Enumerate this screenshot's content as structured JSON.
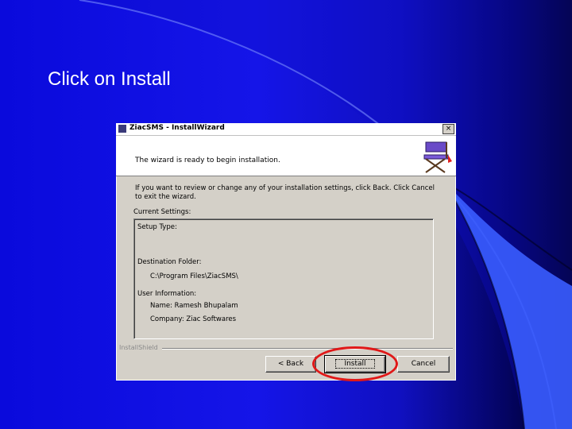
{
  "slide": {
    "title": "Click on Install"
  },
  "dialog": {
    "title": "ZiacSMS - InstallWizard",
    "close_label": "×",
    "banner_text": "The wizard is ready to begin installation.",
    "body_text": "If you want to review or change any of your installation settings, click Back. Click Cancel to exit the wizard.",
    "current_settings_label": "Current Settings:",
    "settings": {
      "setup_type_label": "Setup Type:",
      "destination_label": "Destination Folder:",
      "destination_path": "C:\\Program Files\\ZiacSMS\\",
      "user_info_label": "User Information:",
      "name_line": "Name: Ramesh Bhupalam",
      "company_line": "Company: Ziac Softwares"
    },
    "footer_brand": "InstallShield",
    "buttons": {
      "back": "< Back",
      "install": "Install",
      "cancel": "Cancel"
    }
  },
  "colors": {
    "highlight": "#e01818",
    "slide_bg": "#1515e8"
  }
}
